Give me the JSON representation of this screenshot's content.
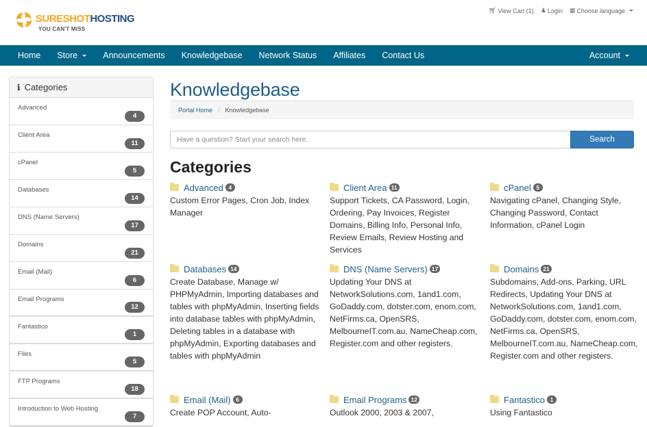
{
  "brand": {
    "name_part1": "SURESHOT",
    "name_part2": "HOSTING",
    "tagline": "YOU CAN'T MISS",
    "colors": {
      "orange": "#f4a623",
      "blue": "#1e4f8a",
      "nav": "#006587",
      "link": "#1f5e8a",
      "button": "#337ab7"
    }
  },
  "top_links": {
    "cart": {
      "icon": "cart-icon",
      "label": "View Cart (1)"
    },
    "login": {
      "icon": "user-icon",
      "label": "Login"
    },
    "language": {
      "icon": "language-icon",
      "label": "Choose language"
    }
  },
  "nav": {
    "items": [
      {
        "label": "Home",
        "dropdown": false
      },
      {
        "label": "Store",
        "dropdown": true
      },
      {
        "label": "Announcements",
        "dropdown": false
      },
      {
        "label": "Knowledgebase",
        "dropdown": false
      },
      {
        "label": "Network Status",
        "dropdown": false
      },
      {
        "label": "Affiliates",
        "dropdown": false
      },
      {
        "label": "Contact Us",
        "dropdown": false
      }
    ],
    "account": {
      "label": "Account",
      "dropdown": true
    }
  },
  "sidebar": {
    "title": "Categories",
    "icon": "info-icon",
    "items": [
      {
        "label": "Advanced",
        "count": "4"
      },
      {
        "label": "Client Area",
        "count": "11"
      },
      {
        "label": "cPanel",
        "count": "5"
      },
      {
        "label": "Databases",
        "count": "14"
      },
      {
        "label": "DNS (Name Servers)",
        "count": "17"
      },
      {
        "label": "Domains",
        "count": "21"
      },
      {
        "label": "Email (Mail)",
        "count": "6"
      },
      {
        "label": "Email Programs",
        "count": "12"
      },
      {
        "label": "Fantastico",
        "count": "1"
      },
      {
        "label": "Files",
        "count": "5"
      },
      {
        "label": "FTP Programs",
        "count": "18"
      },
      {
        "label": "Introduction to Web Hosting",
        "count": "7"
      }
    ]
  },
  "main": {
    "title": "Knowledgebase",
    "breadcrumb": {
      "home": "Portal Home",
      "separator": "/",
      "current": "Knowledgebase"
    },
    "search": {
      "placeholder": "Have a question? Start your search here.",
      "value": "",
      "button": "Search"
    },
    "section_title": "Categories",
    "categories": [
      {
        "name": "Advanced",
        "count": "4",
        "desc": "Custom Error Pages, Cron Job, Index Manager"
      },
      {
        "name": "Client Area",
        "count": "11",
        "desc": "Support Tickets, CA Password, Login, Ordering, Pay Invoices, Register Domains, Billing Info, Personal Info, Review Emails, Review Hosting and Services"
      },
      {
        "name": "cPanel",
        "count": "5",
        "desc": "Navigating cPanel, Changing Style, Changing Password, Contact Information, cPanel Login"
      },
      {
        "name": "Databases",
        "count": "14",
        "desc": "Create Database, Manage w/ PHPMyAdmin, Importing databases and tables with phpMyAdmin, Inserting fields into database tables with phpMyAdmin, Deleting tables in a database with phpMyAdmin, Exporting databases and tables with phpMyAdmin"
      },
      {
        "name": "DNS (Name Servers)",
        "count": "17",
        "desc": "Updating Your DNS at NetworkSolutions.com, 1and1.com, GoDaddy.com, dotster.com, enom.com, NetFirms.ca, OpenSRS, MelbourneIT.com.au, NameCheap.com, Register.com and other registers."
      },
      {
        "name": "Domains",
        "count": "21",
        "desc": "Subdomains, Add-ons, Parking, URL Redirects, Updating Your DNS at NetworkSolutions.com, 1and1.com, GoDaddy.com, dotster.com, enom.com, NetFirms.ca, OpenSRS, MelbourneIT.com.au, NameCheap.com, Register.com and other registers."
      },
      {
        "name": "Email (Mail)",
        "count": "6",
        "desc": "Create POP Account, Auto-"
      },
      {
        "name": "Email Programs",
        "count": "12",
        "desc": "Outlook 2000, 2003 & 2007,"
      },
      {
        "name": "Fantastico",
        "count": "1",
        "desc": "Using Fantastico"
      }
    ]
  }
}
